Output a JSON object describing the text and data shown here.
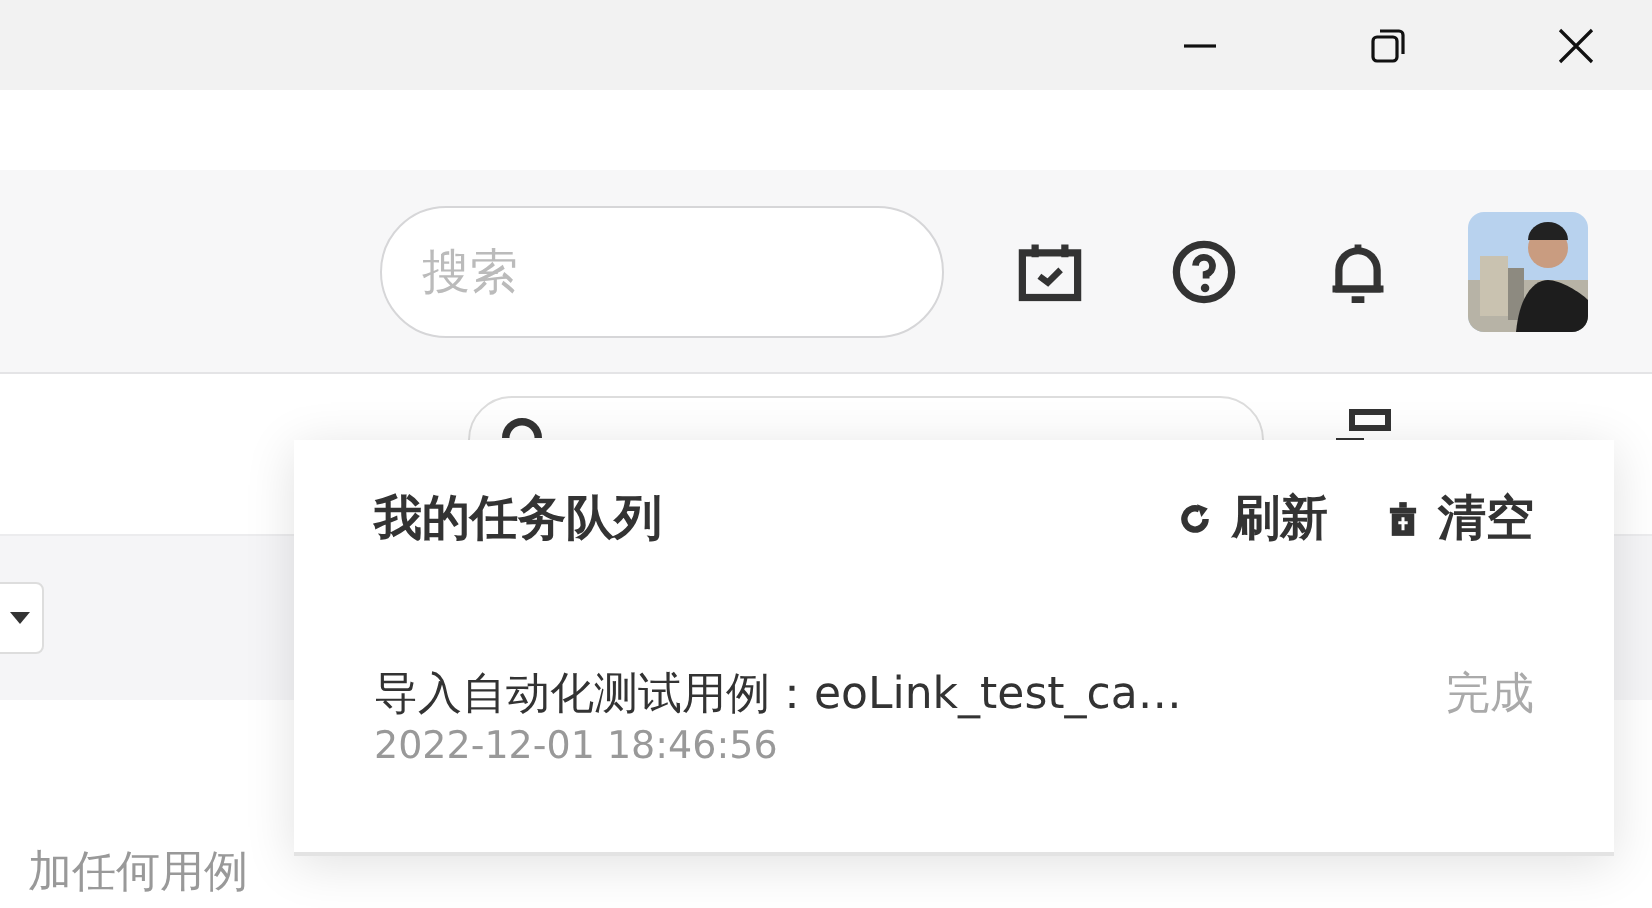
{
  "header": {
    "search": {
      "placeholder": "搜索"
    }
  },
  "empty_text": "加任何用例",
  "task_panel": {
    "title": "我的任务队列",
    "actions": [
      {
        "kind": "refresh",
        "label": "刷新"
      },
      {
        "kind": "clear",
        "label": "清空"
      }
    ],
    "tasks": [
      {
        "name": "导入自动化测试用例：eoLink_test_ca…",
        "status": "完成",
        "time": "2022-12-01 18:46:56"
      }
    ]
  }
}
